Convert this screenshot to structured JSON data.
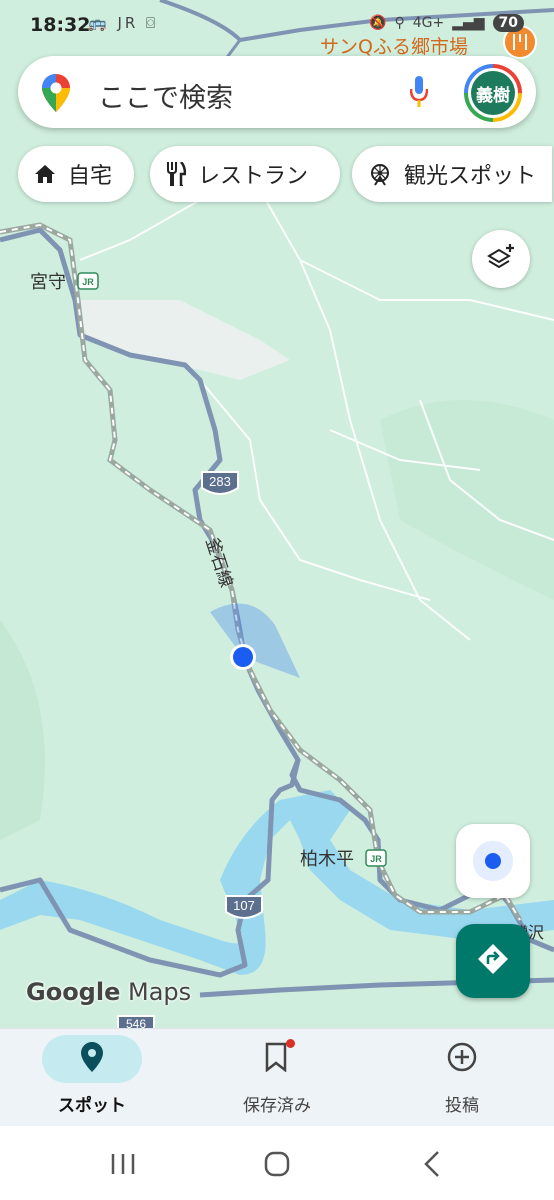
{
  "status_bar": {
    "time": "18:32",
    "left_icons": "🚌 JR ⌼",
    "network": "4G+",
    "battery": "70"
  },
  "search": {
    "placeholder": "ここで検索",
    "avatar_text": "義樹"
  },
  "chips": [
    {
      "label": "自宅",
      "icon": "home-icon"
    },
    {
      "label": "レストラン",
      "icon": "restaurant-icon"
    },
    {
      "label": "観光スポット",
      "icon": "attraction-icon"
    }
  ],
  "map": {
    "poi_label": "サンQふる郷市場",
    "stations": [
      {
        "name": "宮守",
        "badge": "JR"
      },
      {
        "name": "柏木平",
        "badge": "JR"
      }
    ],
    "partial_label": "鱒沢",
    "rail_line": "釜石線",
    "route_shields": [
      "283",
      "107",
      "546"
    ],
    "colors": {
      "land": "#cfeedd",
      "road": "#7f93b3",
      "river": "#9ad8f0",
      "town": "#eaf0ee",
      "my_location": "#1a5df0",
      "accent": "#00796b"
    }
  },
  "logo": {
    "google": "Google",
    "maps": "Maps"
  },
  "bottom_tabs": [
    {
      "label": "スポット",
      "icon": "location-pin-icon",
      "active": true
    },
    {
      "label": "保存済み",
      "icon": "bookmark-icon",
      "active": false
    },
    {
      "label": "投稿",
      "icon": "add-circle-icon",
      "active": false
    }
  ]
}
